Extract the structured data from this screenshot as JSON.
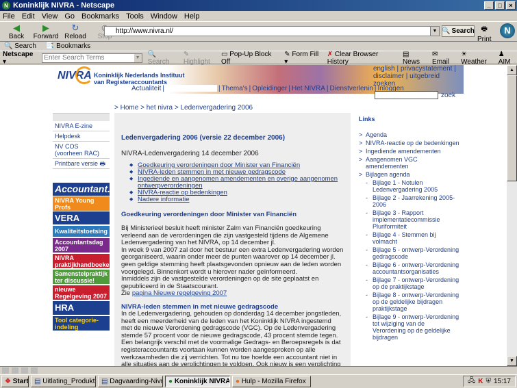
{
  "window": {
    "title": "Koninklijk NIVRA - Netscape"
  },
  "menu": [
    "File",
    "Edit",
    "View",
    "Go",
    "Bookmarks",
    "Tools",
    "Window",
    "Help"
  ],
  "nav": {
    "back": "Back",
    "forward": "Forward",
    "reload": "Reload",
    "stop": "Stop",
    "url": "http://www.nivra.nl/",
    "search": "Search",
    "print": "Print"
  },
  "personal": {
    "search": "Search",
    "bookmarks": "Bookmarks"
  },
  "toolbar2": {
    "netscape": "Netscape",
    "search_placeholder": "Enter Search Terms",
    "search": "Search",
    "highlight": "Highlight",
    "popup": "Pop-Up Block Off",
    "formfill": "Form Fill",
    "clear": "Clear Browser History",
    "news": "News",
    "email": "Email",
    "weather": "Weather",
    "aim": "AIM"
  },
  "site": {
    "logo": "NIVRA",
    "org": "Koninklijk Nederlands Instituut van Registeraccountants",
    "topnav": [
      "Actualiteit",
      "",
      "Thema's",
      "Opleidinger",
      "Het NIVRA",
      "Dienstverlenin",
      "Inloggen"
    ],
    "toplinks": "english | privacystatement | disclaimer | uitgebreid zoeken",
    "zoek": "zoek",
    "crumb": "> Home > het nivra > Ledenvergadering 2006"
  },
  "leftnav": [
    "NIVRA E-zine",
    "Helpdesk",
    "NV COS (voorheen RAC)",
    "Printbare versie"
  ],
  "banners": [
    {
      "t": "Accountant.nl",
      "c": "#1d3f8f"
    },
    {
      "t": "NIVRA Young Profs",
      "c": "#f08a1c"
    },
    {
      "t": "VERA",
      "c": "#1d3f8f"
    },
    {
      "t": "Kwaliteitstoetsing",
      "c": "#2a7ac0"
    },
    {
      "t": "Accountantsdag 2007",
      "c": "#7a2a8a"
    },
    {
      "t": "NIVRA praktijkhandboeken",
      "c": "#c81e2e"
    },
    {
      "t": "Samenstelpraktijk ter discussie!",
      "c": "#4f9a3a"
    },
    {
      "t": "nieuwe Regelgeving 2007",
      "c": "#c81e2e"
    },
    {
      "t": "HRA",
      "c": "#1d3f8f"
    },
    {
      "t": "Tool categorie-indeling",
      "c": "#1d3f8f"
    }
  ],
  "main": {
    "title": "Ledenvergadering 2006 (versie 22 december 2006)",
    "date": "NIVRA-Ledenvergadering 14 december 2006",
    "links": [
      "Goedkeuring verordeningen door Minister van Financiën",
      "NIVRA-leden stemmen in met nieuwe gedragscode",
      "Ingediende en aangenomen amendementen en overige aangenomen ontwerpverordeningen",
      "NIVRA-reactie op bedenkingen",
      "Nadere informatie"
    ],
    "h1": "Goedkeuring verordeningen door Minister van Financiën",
    "p1": "Bij Ministerieel besluit heeft minister Zalm van Financiën goedkeuring verleend aan de verordeningen die zijn vastgesteld tijdens de Algemene Ledenvergadering van het NIVRA, op 14 december jl.",
    "p2": "In week 9 van 2007 zal door het bestuur een extra Ledenvergadering worden georganiseerd, waarin onder meer de punten waarover op 14 december jl. geen geldige stemming heeft plaatsgevonden opnieuw aan de leden worden voorgelegd. Binnenkort wordt u hierover nader geïnformeerd.",
    "p3": "Inmiddels zijn de vastgestelde verordeningen op de site geplaatst en gepubliceerd in de Staatscourant.",
    "p4_pre": "Zie",
    "p4_link": "pagina Nieuwe regelgeving 2007",
    "h2": "NIVRA-leden stemmen in met nieuwe gedragscode",
    "p5": "In de Ledenvergadering, gehouden op donderdag 14 december jongstleden, heeft een meerderheid van de leden van het Koninklijk NIVRA ingestemd met de nieuwe Verordening gedragscode (VGC). Op de Ledenvergadering stemde 57 procent voor de nieuwe gedragscode, 43 procent stemde tegen.",
    "p6": "Een belangrijk verschil met de voormalige Gedrags- en Beroepsregels is dat registeraccountants voortaan kunnen worden aangesproken op alle werkzaamheden die zij verrichten. Tot nu toe hoefde een accountant niet in alle situaties aan de verplichtingen te voldoen. Ook nieuw is een verplichting tot permanente educatie voor accountants met functies in het bedrijfsleven. De nieuwe gedragscode bevat geen verdere verzwaringen ten opzichte van de gedrags- en beroepsregels zoals die tot nu toe golden."
  },
  "right": {
    "heading": "Links",
    "items": [
      {
        "t": "Agenda",
        "s": false
      },
      {
        "t": "NIVRA-reactie op de bedenkingen",
        "s": false
      },
      {
        "t": "Ingediende amendementen",
        "s": false
      },
      {
        "t": "Aangenomen VGC amendementen",
        "s": false
      },
      {
        "t": "Bijlagen agenda",
        "s": false
      },
      {
        "t": "Bijlage 1 - Notulen Ledenvergadering 2005",
        "s": true
      },
      {
        "t": "Bijlage 2 - Jaarrekening 2005-2006",
        "s": true
      },
      {
        "t": "Bijlage 3 - Rapport implementatiecommissie Pluriformiteit",
        "s": true
      },
      {
        "t": "Bijlage 4 - Stemmen bij volmacht",
        "s": true
      },
      {
        "t": "Bijlage 5 - ontwerp-Verordening gedragscode",
        "s": true
      },
      {
        "t": "Bijlage 6 - ontwerp-Verordening accountantsorganisaties",
        "s": true
      },
      {
        "t": "Bijlage 7 - ontwerp-Verordening op de praktijkstage",
        "s": true
      },
      {
        "t": "Bijlage 8 - ontwerp-Verordening op de geldelijke bijdragen praktijkstage",
        "s": true
      },
      {
        "t": "Bijlage 9 - ontwerp-Verordening tot wijziging van de Verordening op de geldelijke bijdragen",
        "s": true
      }
    ]
  },
  "taskbar": {
    "start": "Start",
    "tasks": [
      "Uitlating_Produktie...",
      "Dagvaarding-Nivra...",
      "Koninklijk NIVRA...",
      "Hulp - Mozilla Firefox"
    ],
    "clock": "15:17"
  }
}
